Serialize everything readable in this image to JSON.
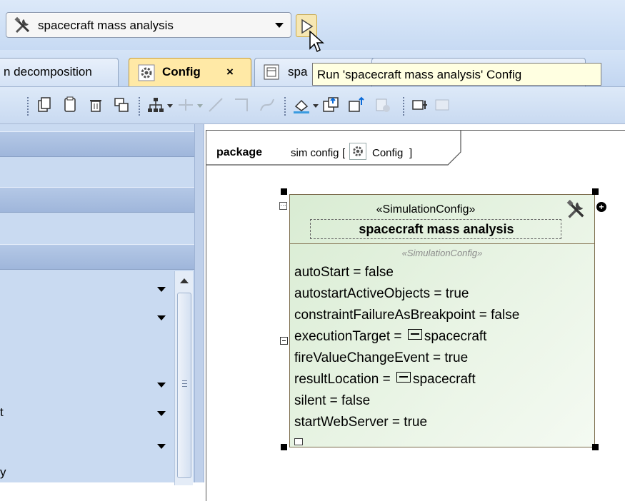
{
  "config_combo": {
    "selected": "spacecraft mass analysis",
    "run_tooltip": "Run 'spacecraft mass analysis' Config"
  },
  "tabs": [
    {
      "label": "n decomposition"
    },
    {
      "label": "Config",
      "close": "×",
      "active": true
    },
    {
      "label": "spa"
    },
    {
      "label": ""
    }
  ],
  "left_panel": {
    "rows": [
      {
        "label": ""
      },
      {
        "label": ""
      },
      {
        "label": ""
      },
      {
        "label": ""
      },
      {
        "label": "t"
      },
      {
        "label": ""
      },
      {
        "label": "y"
      }
    ]
  },
  "diagram": {
    "frame_keyword": "package",
    "frame_name": "sim config",
    "frame_bracket_open": "[",
    "frame_diagram_type": "Config",
    "frame_bracket_close": "]"
  },
  "block": {
    "stereotype": "«SimulationConfig»",
    "name": "spacecraft mass analysis",
    "compartment_label": "«SimulationConfig»",
    "properties": [
      {
        "name": "autoStart",
        "op": " = ",
        "value": "false"
      },
      {
        "name": "autostartActiveObjects",
        "op": " = ",
        "value": "true"
      },
      {
        "name": "constraintFailureAsBreakpoint",
        "op": " = ",
        "value": "false"
      },
      {
        "name": "executionTarget",
        "op": " = ",
        "value": "spacecraft",
        "icon": "block-element-icon"
      },
      {
        "name": "fireValueChangeEvent",
        "op": " = ",
        "value": "true"
      },
      {
        "name": "resultLocation",
        "op": " = ",
        "value": "spacecraft",
        "icon": "block-element-icon"
      },
      {
        "name": "silent",
        "op": " = ",
        "value": "false"
      },
      {
        "name": "startWebServer",
        "op": " = ",
        "value": "true"
      }
    ]
  },
  "colors": {
    "block_fill": "#d9ecd3",
    "active_tab": "#ffe9a6",
    "tooltip_bg": "#ffffe1",
    "chrome_blue": "#c9daf1"
  }
}
